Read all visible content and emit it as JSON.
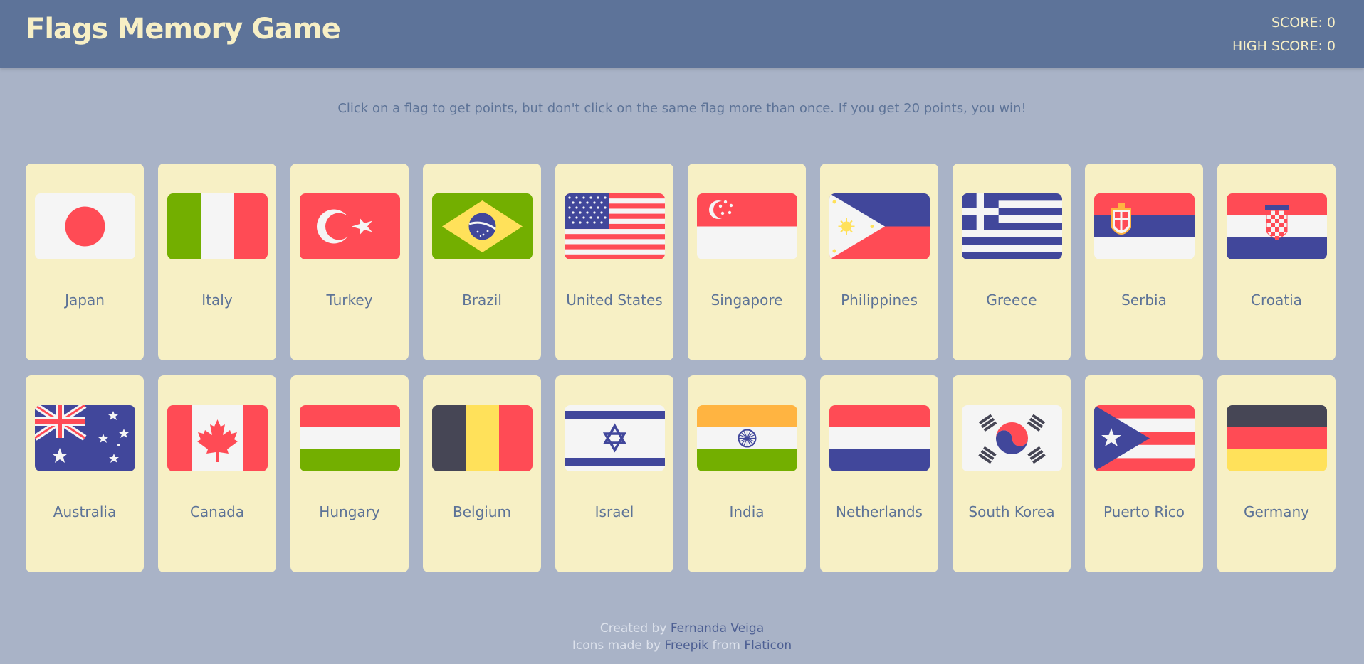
{
  "header": {
    "title": "Flags Memory Game",
    "score_label": "SCORE: 0",
    "high_score_label": "HIGH SCORE: 0"
  },
  "instructions": "Click on a flag to get points, but don't click on the same flag more than once. If you get 20 points, you win!",
  "cards": [
    {
      "name": "Japan",
      "flag_icon": "japan-flag-icon"
    },
    {
      "name": "Italy",
      "flag_icon": "italy-flag-icon"
    },
    {
      "name": "Turkey",
      "flag_icon": "turkey-flag-icon"
    },
    {
      "name": "Brazil",
      "flag_icon": "brazil-flag-icon"
    },
    {
      "name": "United States",
      "flag_icon": "united-states-flag-icon"
    },
    {
      "name": "Singapore",
      "flag_icon": "singapore-flag-icon"
    },
    {
      "name": "Philippines",
      "flag_icon": "philippines-flag-icon"
    },
    {
      "name": "Greece",
      "flag_icon": "greece-flag-icon"
    },
    {
      "name": "Serbia",
      "flag_icon": "serbia-flag-icon"
    },
    {
      "name": "Croatia",
      "flag_icon": "croatia-flag-icon"
    },
    {
      "name": "Australia",
      "flag_icon": "australia-flag-icon"
    },
    {
      "name": "Canada",
      "flag_icon": "canada-flag-icon"
    },
    {
      "name": "Hungary",
      "flag_icon": "hungary-flag-icon"
    },
    {
      "name": "Belgium",
      "flag_icon": "belgium-flag-icon"
    },
    {
      "name": "Israel",
      "flag_icon": "israel-flag-icon"
    },
    {
      "name": "India",
      "flag_icon": "india-flag-icon"
    },
    {
      "name": "Netherlands",
      "flag_icon": "netherlands-flag-icon"
    },
    {
      "name": "South Korea",
      "flag_icon": "south-korea-flag-icon"
    },
    {
      "name": "Puerto Rico",
      "flag_icon": "puerto-rico-flag-icon"
    },
    {
      "name": "Germany",
      "flag_icon": "germany-flag-icon"
    }
  ],
  "footer": {
    "created_prefix": "Created by",
    "author": "Fernanda Veiga",
    "icons_prefix": "Icons made by",
    "icons_author": "Freepik",
    "icons_from": "from",
    "icons_source": "Flaticon"
  },
  "colors": {
    "header_bg": "#5d7399",
    "page_bg": "#a9b3c7",
    "card_bg": "#f7f0c5",
    "title_text": "#f7efc5",
    "body_text": "#5d7397",
    "flag_red": "#ff4b55",
    "flag_blue": "#41479b",
    "flag_green": "#73af00",
    "flag_white": "#f5f5f5",
    "flag_yellow": "#ffe15a",
    "flag_orange": "#ffb441",
    "flag_dark": "#464655"
  }
}
